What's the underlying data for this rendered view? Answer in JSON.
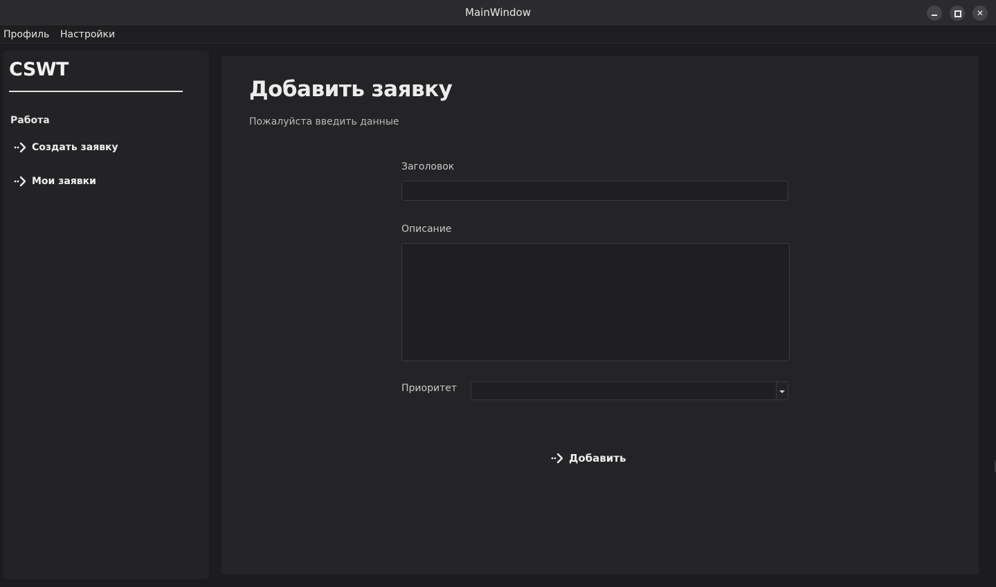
{
  "window": {
    "title": "MainWindow"
  },
  "menubar": {
    "items": [
      {
        "label": "Профиль"
      },
      {
        "label": "Настройки"
      }
    ]
  },
  "sidebar": {
    "logo": "CSWT",
    "section_label": "Работа",
    "items": [
      {
        "label": "Создать заявку",
        "icon": "arrow-right-icon"
      },
      {
        "label": "Мои заявки",
        "icon": "arrow-right-icon"
      }
    ]
  },
  "main": {
    "title": "Добавить заявку",
    "subtitle": "Пожалуйста введить данные",
    "fields": {
      "title_label": "Заголовок",
      "title_value": "",
      "description_label": "Описание",
      "description_value": "",
      "priority_label": "Приоритет",
      "priority_value": ""
    },
    "submit_label": "Добавить"
  },
  "colors": {
    "background": "#1c1c1e",
    "sidebar": "#232325",
    "panel": "#242426",
    "text": "#ececec",
    "muted_text": "#b8b8b8"
  }
}
